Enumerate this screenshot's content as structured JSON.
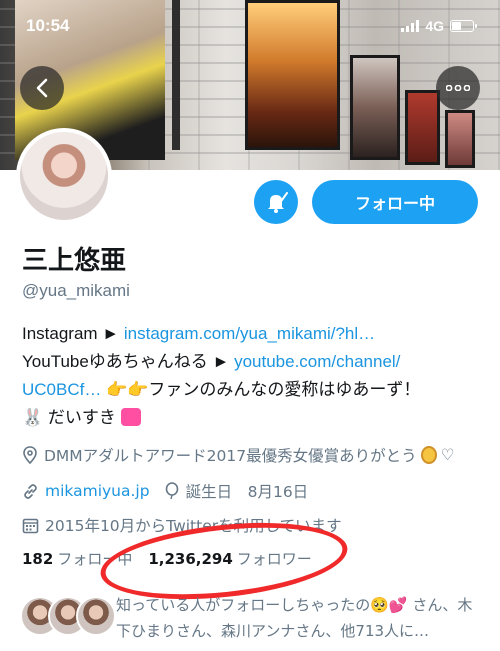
{
  "status_bar": {
    "time": "10:54",
    "network": "4G"
  },
  "profile": {
    "name": "三上悠亜",
    "handle": "@yua_mikami",
    "follow_button": "フォロー中"
  },
  "bio": {
    "line1_prefix": "Instagram ► ",
    "line1_link": "instagram.com/yua_mikami/?hl…",
    "line2_prefix": "YouTubeゆあちゃんねる ► ",
    "line2_link": "youtube.com/channel/",
    "line3_link": "UC0BCf…",
    "line3_suffix": " 👉👉ファンのみんなの愛称はゆあーず！",
    "line4": "🐰 だいすき"
  },
  "meta": {
    "location": "DMMアダルトアワード2017最優秀女優賞ありがとう",
    "location_suffix": "♡",
    "website": "mikamiyua.jp",
    "birthday": "誕生日　8月16日",
    "joined": "2015年10月からTwitterを利用しています"
  },
  "stats": {
    "following_count": "182",
    "following_label": "フォロー中",
    "followers_count": "1,236,294",
    "followers_label": "フォロワー"
  },
  "followers_you_know": {
    "line1": "知っている人がフォローしちゃったの🥺💕 さん、木",
    "line2": "下ひまりさん、森川アンナさん、他713人に…"
  },
  "colors": {
    "accent": "#1da1f2",
    "link": "#1b95e0",
    "annotation": "#f02a2a"
  }
}
